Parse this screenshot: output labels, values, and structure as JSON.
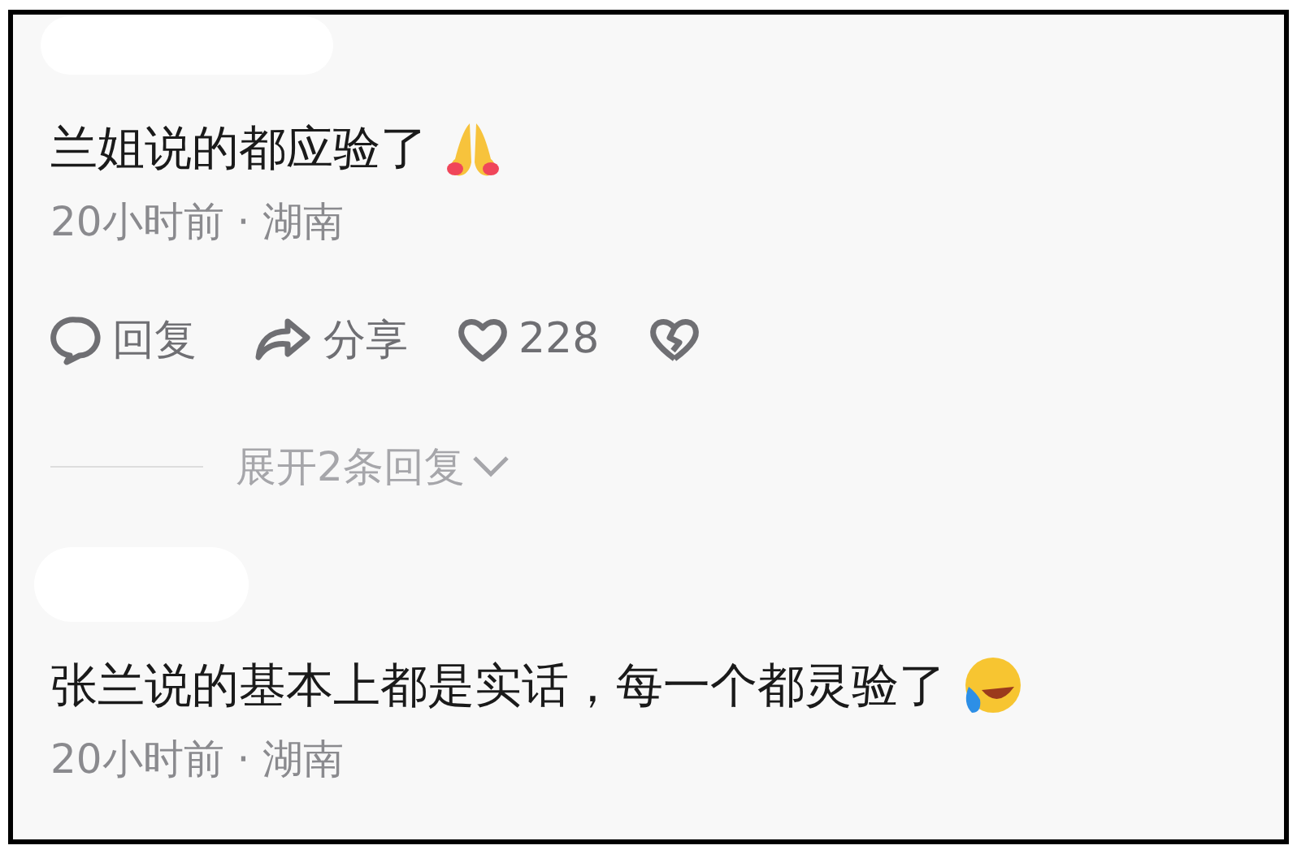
{
  "comments": [
    {
      "text": "兰姐说的都应验了",
      "emoji": {
        "kind": "pray"
      },
      "meta": "20小时前 · 湖南",
      "actions": {
        "reply": "回复",
        "share": "分享",
        "likes": "228"
      },
      "expand": "展开2条回复"
    },
    {
      "text": "张兰说的基本上都是实话，每一个都灵验了",
      "emoji": {
        "kind": "laugh"
      },
      "meta": "20小时前 · 湖南"
    }
  ]
}
